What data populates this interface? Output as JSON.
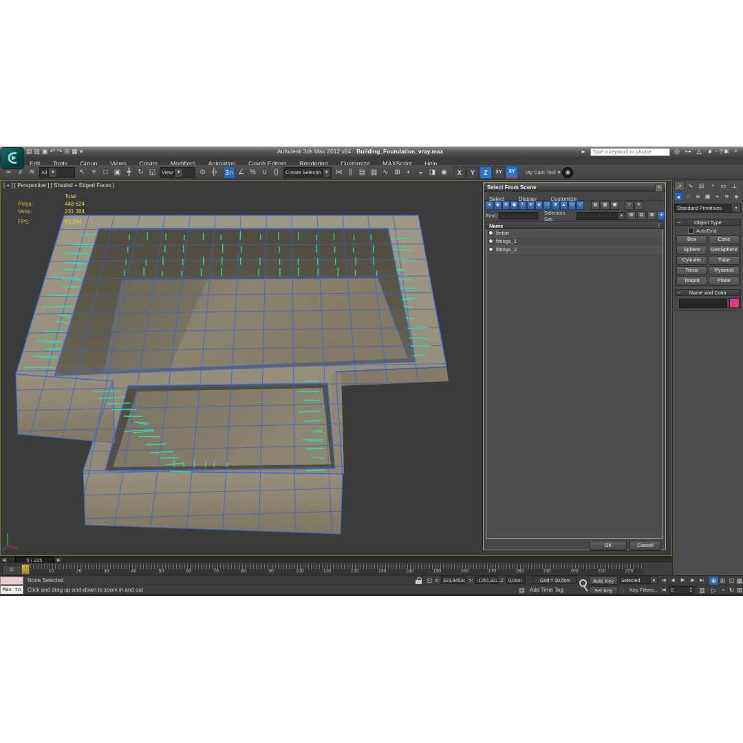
{
  "window": {
    "app_title": "Autodesk 3ds Max  2012 x64",
    "doc_title": "Building_Foundation_vray.max",
    "search_placeholder": "Type a keyword or phrase"
  },
  "menu": {
    "items": [
      "Edit",
      "Tools",
      "Group",
      "Views",
      "Create",
      "Modifiers",
      "Animation",
      "Graph Editors",
      "Rendering",
      "Customize",
      "MAXScript",
      "Help"
    ]
  },
  "toolbar": {
    "filter_dropdown": "All",
    "ref_coord_dropdown": "View",
    "named_sets_dropdown": "Create Selection Se",
    "axis_x": "X",
    "axis_y": "Y",
    "axis_z": "Z",
    "axis_xy": "XY",
    "axis_xy2": "XY",
    "snap_label": "3",
    "cam_tool": "uty Cam Tool"
  },
  "viewport": {
    "label": "[ + ] [ Perspective ] [ Shaded + Edged Faces ]",
    "stats": {
      "total_label": "Total",
      "polys_label": "Polys:",
      "polys": "448 624",
      "verts_label": "Verts:",
      "verts": "231 384",
      "fps_label": "FPS:",
      "fps": "82,264"
    }
  },
  "scene_dialog": {
    "title": "Select From Scene",
    "menus": [
      "Select",
      "Display",
      "Customize"
    ],
    "find_label": "Find:",
    "selection_set_label": "Selection Set:",
    "name_header": "Name",
    "sort_glyph": "/",
    "items": [
      "beton",
      "fittings_1",
      "fittings_2"
    ],
    "ok": "OK",
    "cancel": "Cancel"
  },
  "command_panel": {
    "category_dropdown": "Standard Primitives",
    "object_type_header": "Object Type",
    "autogrid": "AutoGrid",
    "primitives": [
      "Box",
      "Cone",
      "Sphere",
      "GeoSphere",
      "Cylinder",
      "Tube",
      "Torus",
      "Pyramid",
      "Teapot",
      "Plane"
    ],
    "name_color_header": "Name and Color",
    "color_swatch": "#e03a8a"
  },
  "timeline": {
    "frame_display": "0 / 225",
    "tick_labels": [
      10,
      20,
      30,
      40,
      50,
      60,
      70,
      80,
      90,
      100,
      110,
      120,
      130,
      140,
      150,
      160,
      170,
      180,
      190,
      200,
      210,
      220
    ]
  },
  "status": {
    "selection": "None Selected",
    "x_label": "X:",
    "x": "323,9453c",
    "y_label": "Y:",
    "y": "-1261,822",
    "z_label": "Z:",
    "z": "0,0cm",
    "grid": "Grid = 10,0cm",
    "add_time_tag": "Add Time Tag",
    "auto_key": "Auto Key",
    "set_key": "Set Key",
    "key_mode_dropdown": "Selected",
    "key_filters": "Key Filters...",
    "frame_field": "0",
    "listener": "Max to",
    "prompt": "Click and drag up-and-down to zoom in and out"
  },
  "icons": {
    "caret": "▾",
    "qa": [
      "▤",
      "▥",
      "▣",
      "↶",
      "↷",
      "⊞",
      "▦",
      "▾"
    ],
    "search_go": "▸",
    "binoculars": "◎",
    "key": "⊶",
    "satellite": "△",
    "star": "★",
    "help": "?",
    "minimize": "–",
    "restore": "▣",
    "close": "×",
    "link": "∞",
    "unlink": "≠",
    "bind": "≋",
    "select": "↖",
    "select_by_name": "≡",
    "rect_region": "□",
    "window_crossing": "▣",
    "move": "╋",
    "rotate": "↻",
    "scale": "◱",
    "pivot": "⊙",
    "manipulate": "╬",
    "snap_magnet": "∩",
    "angle_snap": "∠",
    "percent_snap": "%",
    "spinner_snap": "∪",
    "named_sets": "{}",
    "mirror": "⋈",
    "align": "∥",
    "layers": "▤",
    "ribbon": "▥",
    "curve_editor": "∿",
    "schematic": "⊞",
    "material": "◐",
    "render_setup": "◒",
    "rfw": "◨",
    "render": "◉",
    "cam_ball": "◉",
    "dialog_toggles": [
      "●",
      "◆",
      "⊛",
      "▣",
      "+",
      "≋",
      "◈",
      "□",
      "⊕",
      "▲",
      "◇",
      "○"
    ],
    "dialog_lists": [
      "▤",
      "▥",
      "▦"
    ],
    "dialog_filters": [
      "▽",
      "▼"
    ],
    "selset_btns": [
      "⊞",
      "⊟",
      "⊠"
    ],
    "selset_hl": "▾",
    "panel_tabs": [
      "↗",
      "∿",
      "⊟",
      "◔",
      "▭",
      "⊥"
    ],
    "panel_subs": [
      "●",
      "∩",
      "⊛",
      "▣",
      "+",
      "≋",
      "◈"
    ],
    "mini_listener": "≣",
    "track_prev": "◄",
    "track_next": "►",
    "transform_gizmo": "⊡",
    "clipboard": "▤",
    "red_slash": "╲",
    "pb": [
      "|◀",
      "◀|",
      "▶",
      "|▶",
      "▶|"
    ],
    "nav1": [
      "⊕",
      "⊞",
      "⊡",
      "▩"
    ],
    "nav2": [
      "▷",
      "◔",
      "↻",
      "⊠"
    ],
    "key_mode": "|◀",
    "save_sel": "▥",
    "spin_up": "▴",
    "spin_dn": "▾"
  }
}
